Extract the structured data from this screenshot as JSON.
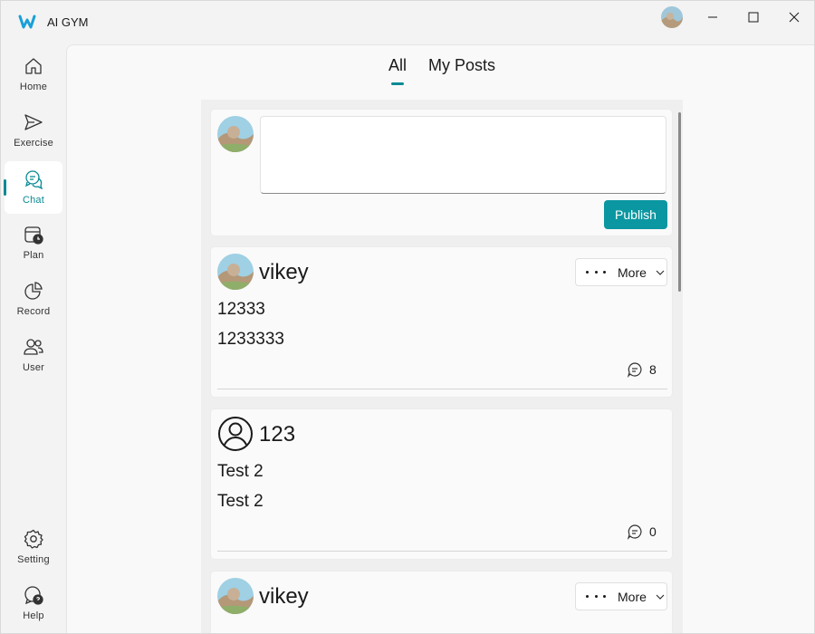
{
  "app": {
    "title": "AI GYM"
  },
  "sidebar": {
    "items": [
      {
        "label": "Home",
        "icon": "home-icon"
      },
      {
        "label": "Exercise",
        "icon": "send-icon"
      },
      {
        "label": "Chat",
        "icon": "chat-icon",
        "active": true
      },
      {
        "label": "Plan",
        "icon": "calendar-clock-icon"
      },
      {
        "label": "Record",
        "icon": "pie-chart-icon"
      },
      {
        "label": "User",
        "icon": "people-icon"
      }
    ],
    "bottom": [
      {
        "label": "Setting",
        "icon": "gear-icon"
      },
      {
        "label": "Help",
        "icon": "help-chat-icon"
      }
    ]
  },
  "tabs": [
    {
      "label": "All",
      "selected": true
    },
    {
      "label": "My Posts",
      "selected": false
    }
  ],
  "composer": {
    "value": "",
    "publish_label": "Publish"
  },
  "posts": [
    {
      "user": "vikey",
      "lines": [
        "12333",
        "1233333"
      ],
      "comments": "8",
      "more_label": "More",
      "avatar": "photo"
    },
    {
      "user": "123",
      "lines": [
        "Test 2",
        "Test 2"
      ],
      "comments": "0",
      "avatar": "default"
    },
    {
      "user": "vikey",
      "more_label": "More",
      "avatar": "photo"
    }
  ],
  "colors": {
    "accent": "#0b97a1",
    "active_nav": "#0b8a94"
  }
}
